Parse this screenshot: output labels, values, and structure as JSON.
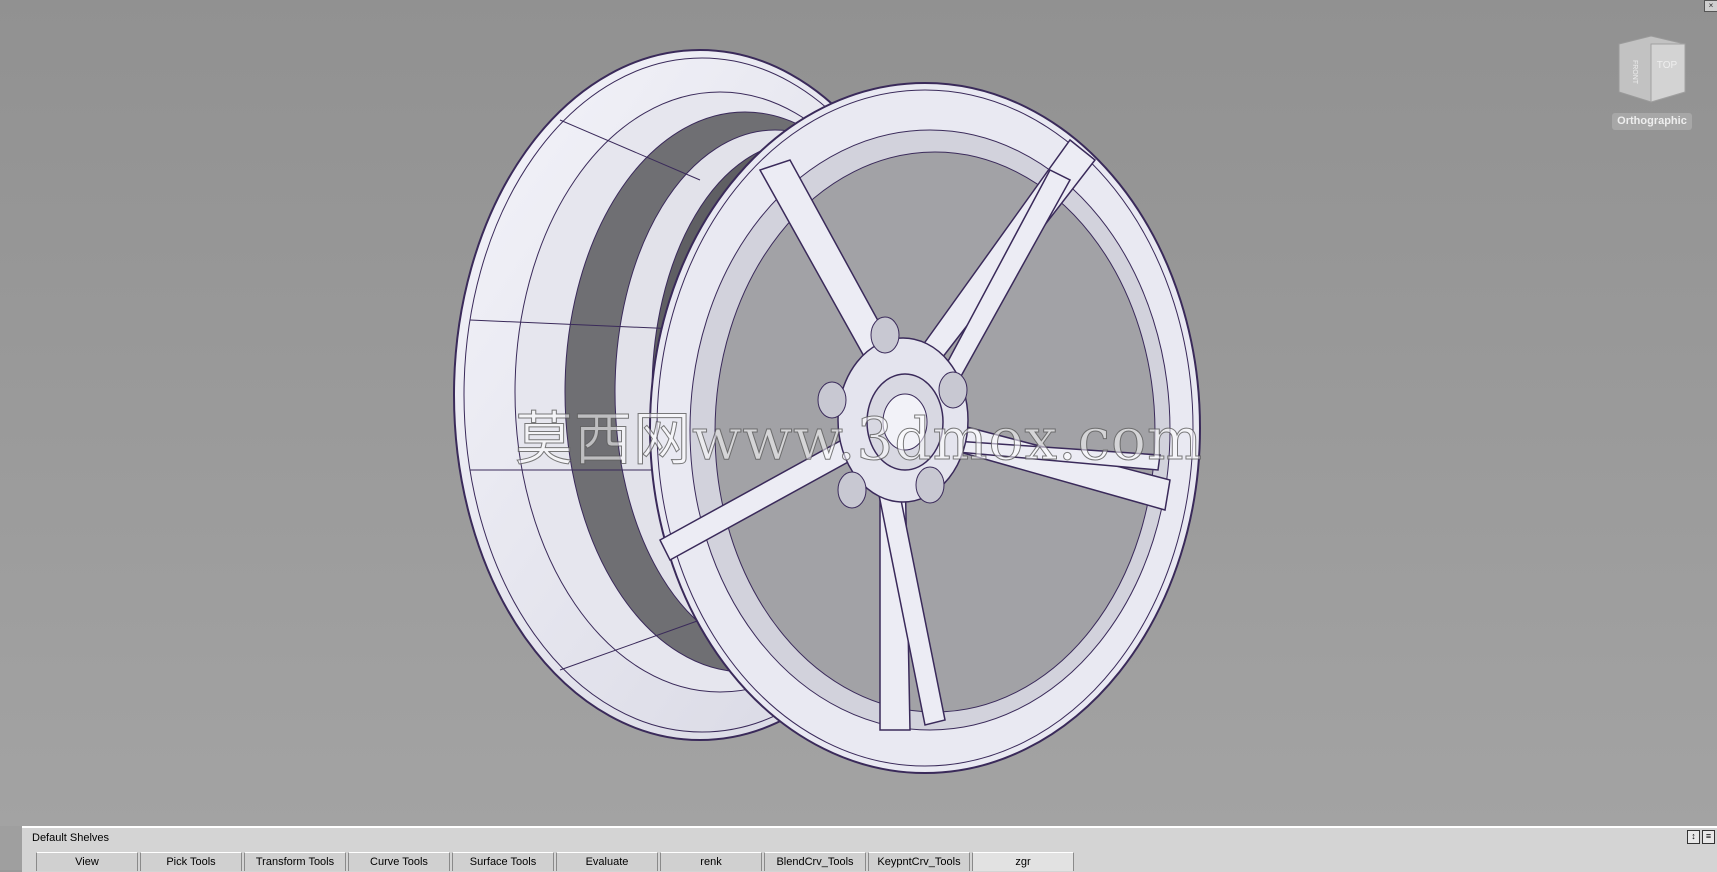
{
  "viewport": {
    "watermark": "莫西网www.3dmox.com",
    "view_mode": "Orthographic",
    "viewcube": {
      "front_label": "FRONT",
      "top_label": "TOP"
    },
    "colors": {
      "background": "#9a9a9a",
      "wire": "#3a2a5a",
      "surface": "#e8e8f0",
      "shadow": "#6e6e72"
    }
  },
  "shelf": {
    "title": "Default Shelves",
    "tabs": [
      {
        "label": "View"
      },
      {
        "label": "Pick Tools"
      },
      {
        "label": "Transform Tools"
      },
      {
        "label": "Curve Tools"
      },
      {
        "label": "Surface Tools"
      },
      {
        "label": "Evaluate"
      },
      {
        "label": "renk"
      },
      {
        "label": "BlendCrv_Tools"
      },
      {
        "label": "KeypntCrv_Tools"
      },
      {
        "label": "zgr"
      }
    ],
    "active_tab": "zgr"
  }
}
